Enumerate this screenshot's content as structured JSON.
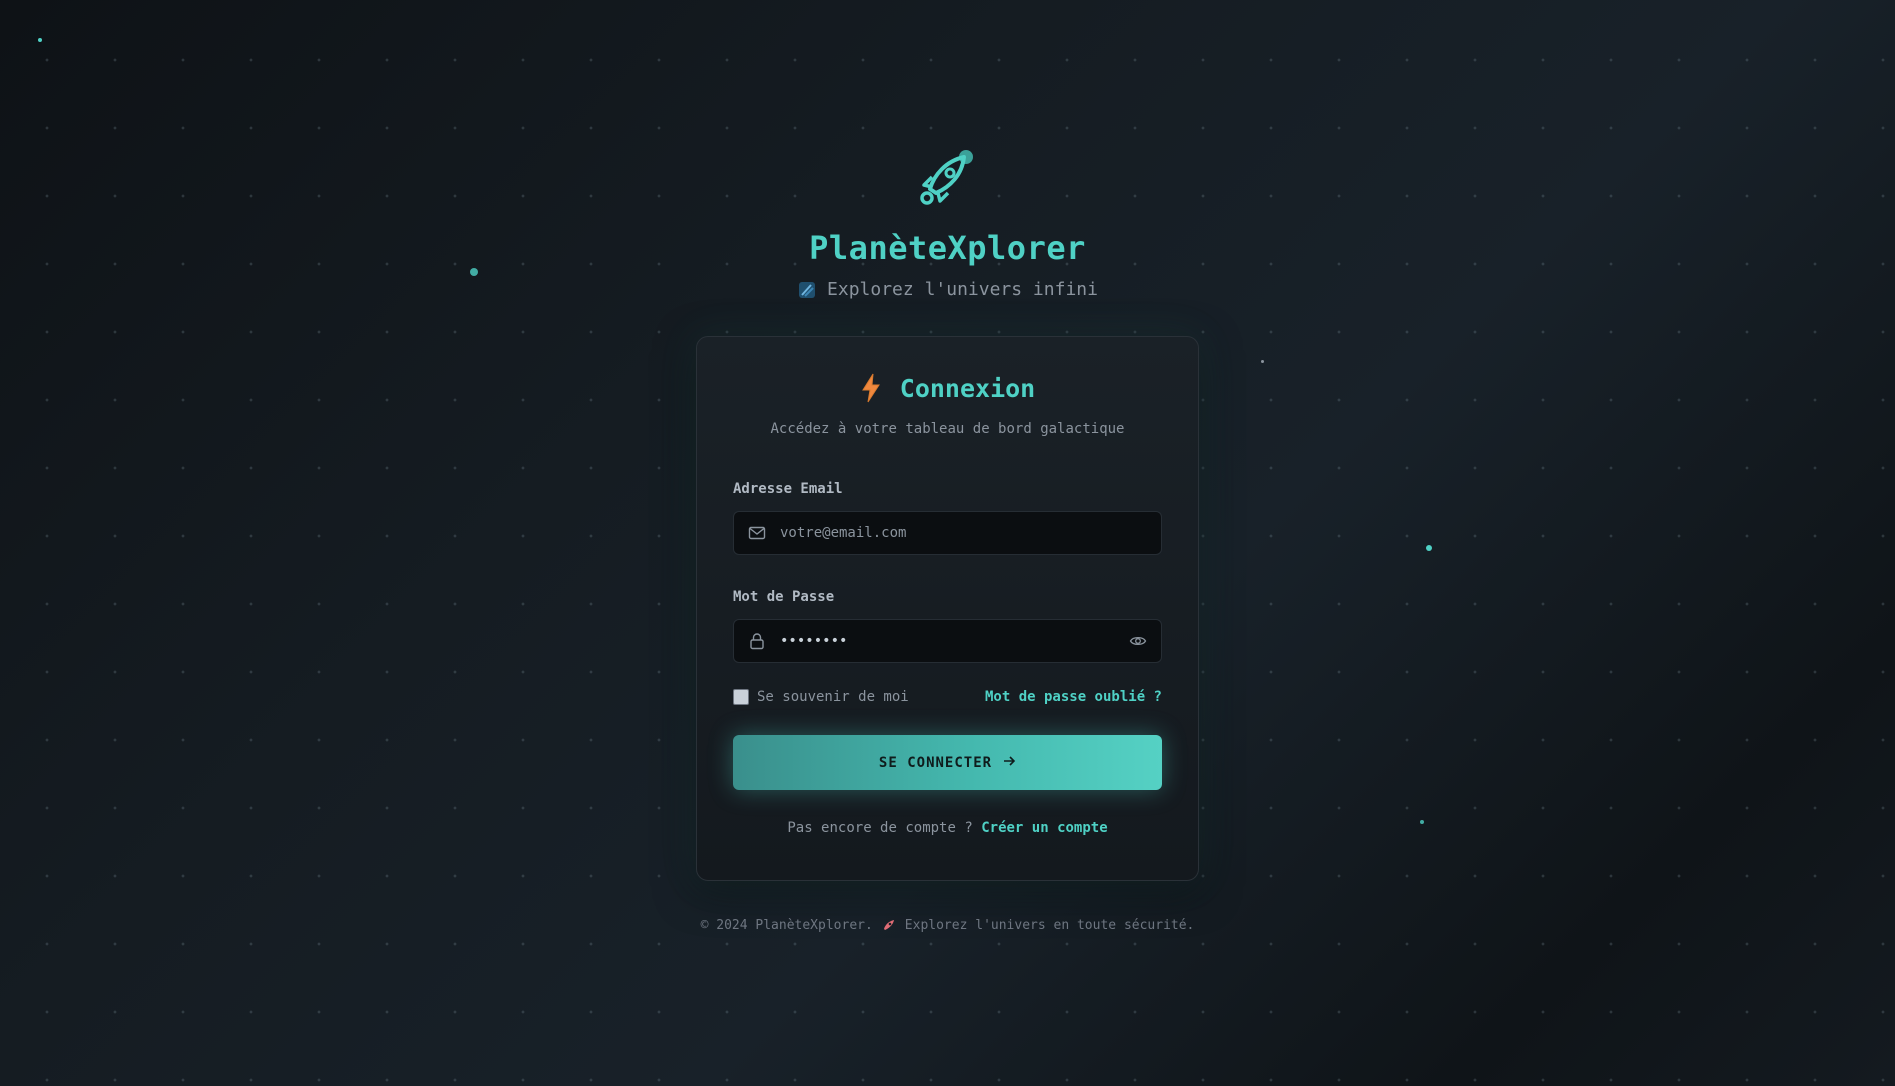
{
  "brand": {
    "title": "PlanèteXplorer",
    "subtitle": "Explorez l'univers infini",
    "logo_icon": "rocket-icon",
    "accent_color": "#4fd1c5"
  },
  "card": {
    "title": "Connexion",
    "subtitle": "Accédez à votre tableau de bord galactique",
    "title_icon": "lightning-bolt-icon"
  },
  "form": {
    "email_label": "Adresse Email",
    "email_placeholder": "votre@email.com",
    "email_value": "",
    "password_label": "Mot de Passe",
    "password_value": "••••••••",
    "remember_label": "Se souvenir de moi",
    "remember_checked": false,
    "forgot_link": "Mot de passe oublié ?",
    "submit_label": "SE CONNECTER"
  },
  "signup": {
    "prompt": "Pas encore de compte ?",
    "link": "Créer un compte"
  },
  "footer": {
    "copyright": "© 2024 PlanèteXplorer.",
    "tagline": "Explorez l'univers en toute sécurité."
  }
}
